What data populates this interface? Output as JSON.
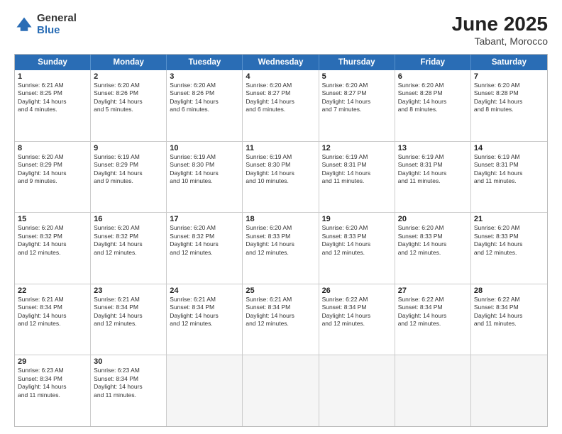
{
  "logo": {
    "general": "General",
    "blue": "Blue"
  },
  "title": "June 2025",
  "subtitle": "Tabant, Morocco",
  "header_days": [
    "Sunday",
    "Monday",
    "Tuesday",
    "Wednesday",
    "Thursday",
    "Friday",
    "Saturday"
  ],
  "rows": [
    [
      {
        "day": "1",
        "info": "Sunrise: 6:21 AM\nSunset: 8:25 PM\nDaylight: 14 hours\nand 4 minutes."
      },
      {
        "day": "2",
        "info": "Sunrise: 6:20 AM\nSunset: 8:26 PM\nDaylight: 14 hours\nand 5 minutes."
      },
      {
        "day": "3",
        "info": "Sunrise: 6:20 AM\nSunset: 8:26 PM\nDaylight: 14 hours\nand 6 minutes."
      },
      {
        "day": "4",
        "info": "Sunrise: 6:20 AM\nSunset: 8:27 PM\nDaylight: 14 hours\nand 6 minutes."
      },
      {
        "day": "5",
        "info": "Sunrise: 6:20 AM\nSunset: 8:27 PM\nDaylight: 14 hours\nand 7 minutes."
      },
      {
        "day": "6",
        "info": "Sunrise: 6:20 AM\nSunset: 8:28 PM\nDaylight: 14 hours\nand 8 minutes."
      },
      {
        "day": "7",
        "info": "Sunrise: 6:20 AM\nSunset: 8:28 PM\nDaylight: 14 hours\nand 8 minutes."
      }
    ],
    [
      {
        "day": "8",
        "info": "Sunrise: 6:20 AM\nSunset: 8:29 PM\nDaylight: 14 hours\nand 9 minutes."
      },
      {
        "day": "9",
        "info": "Sunrise: 6:19 AM\nSunset: 8:29 PM\nDaylight: 14 hours\nand 9 minutes."
      },
      {
        "day": "10",
        "info": "Sunrise: 6:19 AM\nSunset: 8:30 PM\nDaylight: 14 hours\nand 10 minutes."
      },
      {
        "day": "11",
        "info": "Sunrise: 6:19 AM\nSunset: 8:30 PM\nDaylight: 14 hours\nand 10 minutes."
      },
      {
        "day": "12",
        "info": "Sunrise: 6:19 AM\nSunset: 8:31 PM\nDaylight: 14 hours\nand 11 minutes."
      },
      {
        "day": "13",
        "info": "Sunrise: 6:19 AM\nSunset: 8:31 PM\nDaylight: 14 hours\nand 11 minutes."
      },
      {
        "day": "14",
        "info": "Sunrise: 6:19 AM\nSunset: 8:31 PM\nDaylight: 14 hours\nand 11 minutes."
      }
    ],
    [
      {
        "day": "15",
        "info": "Sunrise: 6:20 AM\nSunset: 8:32 PM\nDaylight: 14 hours\nand 12 minutes."
      },
      {
        "day": "16",
        "info": "Sunrise: 6:20 AM\nSunset: 8:32 PM\nDaylight: 14 hours\nand 12 minutes."
      },
      {
        "day": "17",
        "info": "Sunrise: 6:20 AM\nSunset: 8:32 PM\nDaylight: 14 hours\nand 12 minutes."
      },
      {
        "day": "18",
        "info": "Sunrise: 6:20 AM\nSunset: 8:33 PM\nDaylight: 14 hours\nand 12 minutes."
      },
      {
        "day": "19",
        "info": "Sunrise: 6:20 AM\nSunset: 8:33 PM\nDaylight: 14 hours\nand 12 minutes."
      },
      {
        "day": "20",
        "info": "Sunrise: 6:20 AM\nSunset: 8:33 PM\nDaylight: 14 hours\nand 12 minutes."
      },
      {
        "day": "21",
        "info": "Sunrise: 6:20 AM\nSunset: 8:33 PM\nDaylight: 14 hours\nand 12 minutes."
      }
    ],
    [
      {
        "day": "22",
        "info": "Sunrise: 6:21 AM\nSunset: 8:34 PM\nDaylight: 14 hours\nand 12 minutes."
      },
      {
        "day": "23",
        "info": "Sunrise: 6:21 AM\nSunset: 8:34 PM\nDaylight: 14 hours\nand 12 minutes."
      },
      {
        "day": "24",
        "info": "Sunrise: 6:21 AM\nSunset: 8:34 PM\nDaylight: 14 hours\nand 12 minutes."
      },
      {
        "day": "25",
        "info": "Sunrise: 6:21 AM\nSunset: 8:34 PM\nDaylight: 14 hours\nand 12 minutes."
      },
      {
        "day": "26",
        "info": "Sunrise: 6:22 AM\nSunset: 8:34 PM\nDaylight: 14 hours\nand 12 minutes."
      },
      {
        "day": "27",
        "info": "Sunrise: 6:22 AM\nSunset: 8:34 PM\nDaylight: 14 hours\nand 12 minutes."
      },
      {
        "day": "28",
        "info": "Sunrise: 6:22 AM\nSunset: 8:34 PM\nDaylight: 14 hours\nand 11 minutes."
      }
    ],
    [
      {
        "day": "29",
        "info": "Sunrise: 6:23 AM\nSunset: 8:34 PM\nDaylight: 14 hours\nand 11 minutes."
      },
      {
        "day": "30",
        "info": "Sunrise: 6:23 AM\nSunset: 8:34 PM\nDaylight: 14 hours\nand 11 minutes."
      },
      {
        "day": "",
        "info": ""
      },
      {
        "day": "",
        "info": ""
      },
      {
        "day": "",
        "info": ""
      },
      {
        "day": "",
        "info": ""
      },
      {
        "day": "",
        "info": ""
      }
    ]
  ]
}
